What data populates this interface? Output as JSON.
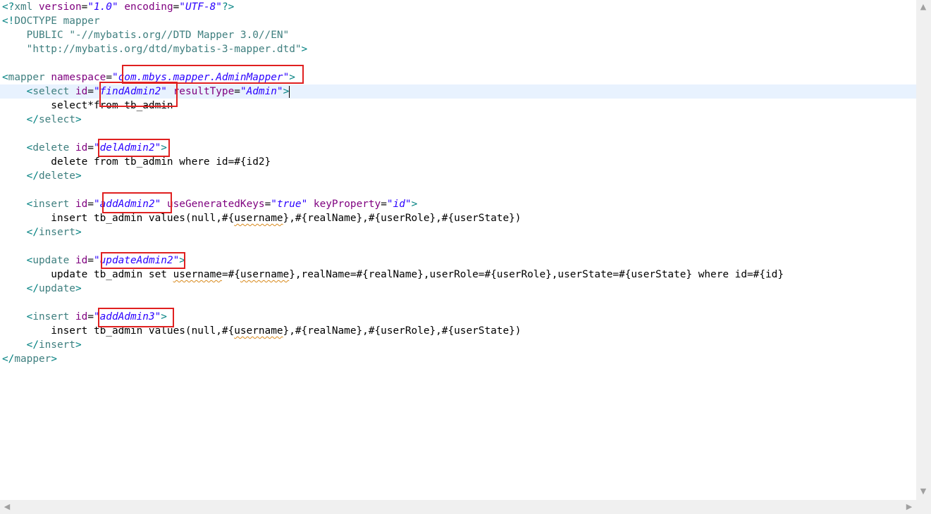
{
  "editor": {
    "lines": [
      [
        [
          "b",
          "<?"
        ],
        [
          "t",
          "xml "
        ],
        [
          "a",
          "version"
        ],
        [
          "x",
          "="
        ],
        [
          "v",
          "\"1.0\""
        ],
        [
          "x",
          " "
        ],
        [
          "a",
          "encoding"
        ],
        [
          "x",
          "="
        ],
        [
          "v",
          "\"UTF-8\""
        ],
        [
          "b",
          "?>"
        ]
      ],
      [
        [
          "b",
          "<!"
        ],
        [
          "d",
          "DOCTYPE mapper"
        ]
      ],
      [
        [
          "d",
          "    PUBLIC "
        ],
        [
          "d",
          "\"-//mybatis.org//DTD Mapper 3.0//EN\""
        ]
      ],
      [
        [
          "d",
          "    \"http://mybatis.org/dtd/mybatis-3-mapper.dtd\""
        ],
        [
          "b",
          ">"
        ]
      ],
      [],
      [
        [
          "b",
          "<"
        ],
        [
          "t",
          "mapper "
        ],
        [
          "a",
          "namespace"
        ],
        [
          "x",
          "="
        ],
        [
          "v",
          "\"com.mbys.mapper.AdminMapper\""
        ],
        [
          "b",
          ">"
        ]
      ],
      [
        [
          "x",
          "    "
        ],
        [
          "b",
          "<"
        ],
        [
          "t",
          "select "
        ],
        [
          "a",
          "id"
        ],
        [
          "x",
          "="
        ],
        [
          "v",
          "\"findAdmin2\""
        ],
        [
          "x",
          " "
        ],
        [
          "a",
          "resultType"
        ],
        [
          "x",
          "="
        ],
        [
          "v",
          "\"Admin\""
        ],
        [
          "b",
          ">"
        ],
        [
          "caret",
          ""
        ]
      ],
      [
        [
          "x",
          "        select*from tb_admin"
        ]
      ],
      [
        [
          "x",
          "    "
        ],
        [
          "b",
          "</"
        ],
        [
          "t",
          "select"
        ],
        [
          "b",
          ">"
        ]
      ],
      [],
      [
        [
          "x",
          "    "
        ],
        [
          "b",
          "<"
        ],
        [
          "t",
          "delete "
        ],
        [
          "a",
          "id"
        ],
        [
          "x",
          "="
        ],
        [
          "v",
          "\"delAdmin2\""
        ],
        [
          "b",
          ">"
        ]
      ],
      [
        [
          "x",
          "        delete from tb_admin where id=#{id2}"
        ]
      ],
      [
        [
          "x",
          "    "
        ],
        [
          "b",
          "</"
        ],
        [
          "t",
          "delete"
        ],
        [
          "b",
          ">"
        ]
      ],
      [],
      [
        [
          "x",
          "    "
        ],
        [
          "b",
          "<"
        ],
        [
          "t",
          "insert "
        ],
        [
          "a",
          "id"
        ],
        [
          "x",
          "="
        ],
        [
          "v",
          "\"addAdmin2\""
        ],
        [
          "x",
          " "
        ],
        [
          "a",
          "useGeneratedKeys"
        ],
        [
          "x",
          "="
        ],
        [
          "v",
          "\"true\""
        ],
        [
          "x",
          " "
        ],
        [
          "a",
          "keyProperty"
        ],
        [
          "x",
          "="
        ],
        [
          "v",
          "\"id\""
        ],
        [
          "b",
          ">"
        ]
      ],
      [
        [
          "x",
          "        insert tb_admin values(null,#{"
        ],
        [
          "s",
          "username"
        ],
        [
          "x",
          "},#{realName},#{userRole},#{userState})"
        ]
      ],
      [
        [
          "x",
          "    "
        ],
        [
          "b",
          "</"
        ],
        [
          "t",
          "insert"
        ],
        [
          "b",
          ">"
        ]
      ],
      [],
      [
        [
          "x",
          "    "
        ],
        [
          "b",
          "<"
        ],
        [
          "t",
          "update "
        ],
        [
          "a",
          "id"
        ],
        [
          "x",
          "="
        ],
        [
          "v",
          "\"updateAdmin2\""
        ],
        [
          "b",
          ">"
        ]
      ],
      [
        [
          "x",
          "        update tb_admin set "
        ],
        [
          "s",
          "username"
        ],
        [
          "x",
          "=#{"
        ],
        [
          "s",
          "username"
        ],
        [
          "x",
          "},realName=#{realName},userRole=#{userRole},userState=#{userState} where id=#{id}"
        ]
      ],
      [
        [
          "x",
          "    "
        ],
        [
          "b",
          "</"
        ],
        [
          "t",
          "update"
        ],
        [
          "b",
          ">"
        ]
      ],
      [],
      [
        [
          "x",
          "    "
        ],
        [
          "b",
          "<"
        ],
        [
          "t",
          "insert "
        ],
        [
          "a",
          "id"
        ],
        [
          "x",
          "="
        ],
        [
          "v",
          "\"addAdmin3\""
        ],
        [
          "b",
          ">"
        ]
      ],
      [
        [
          "x",
          "        insert tb_admin values(null,#{"
        ],
        [
          "s",
          "username"
        ],
        [
          "x",
          "},#{realName},#{userRole},#{userState})"
        ]
      ],
      [
        [
          "x",
          "    "
        ],
        [
          "b",
          "</"
        ],
        [
          "t",
          "insert"
        ],
        [
          "b",
          ">"
        ]
      ],
      [
        [
          "b",
          "</"
        ],
        [
          "t",
          "mapper"
        ],
        [
          "b",
          ">"
        ]
      ]
    ],
    "current_line_index": 6
  },
  "highlights": [
    {
      "label": "namespace-value-highlight"
    },
    {
      "label": "findAdmin2-highlight"
    },
    {
      "label": "delAdmin2-highlight"
    },
    {
      "label": "addAdmin2-highlight"
    },
    {
      "label": "updateAdmin2-highlight"
    },
    {
      "label": "addAdmin3-highlight"
    }
  ],
  "scrollbars": {
    "up_icon": "arrow-up-icon",
    "down_icon": "arrow-down-icon",
    "left_icon": "arrow-left-icon",
    "right_icon": "arrow-right-icon"
  },
  "colors": {
    "highlight_border": "#e02020",
    "current_line_bg": "#e8f2fe",
    "attribute": "#7f007f",
    "value": "#2a00ff",
    "tag": "#3f7f7f"
  }
}
